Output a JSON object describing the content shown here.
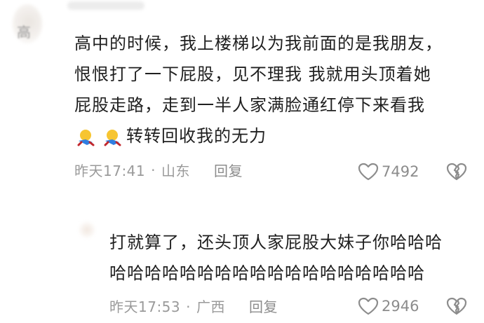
{
  "comment": {
    "lines": [
      "高中的时候，我上楼梯以为我前面的是我朋友，",
      "恨恨打了一下屁股，见不理我 我就用头顶着她",
      "屁股走路，走到一半人家满脸通红停下来看我",
      "转转回收我的无力"
    ],
    "time": "昨天17:41",
    "location": "山东",
    "reply_label": "回复",
    "likes": "7492",
    "icons": [
      "avatar",
      "rolling-laugh-emoji",
      "rolling-laugh-emoji",
      "heart-icon",
      "broken-heart-icon"
    ]
  },
  "reply": {
    "lines": [
      "打就算了，还头顶人家屁股大妹子你哈哈哈",
      "哈哈哈哈哈哈哈哈哈哈哈哈哈哈哈哈哈哈"
    ],
    "time": "昨天17:53",
    "location": "广西",
    "reply_label": "回复",
    "likes": "2946"
  },
  "colors": {
    "text": "#1f1f1f",
    "meta": "#9a9a9a"
  }
}
